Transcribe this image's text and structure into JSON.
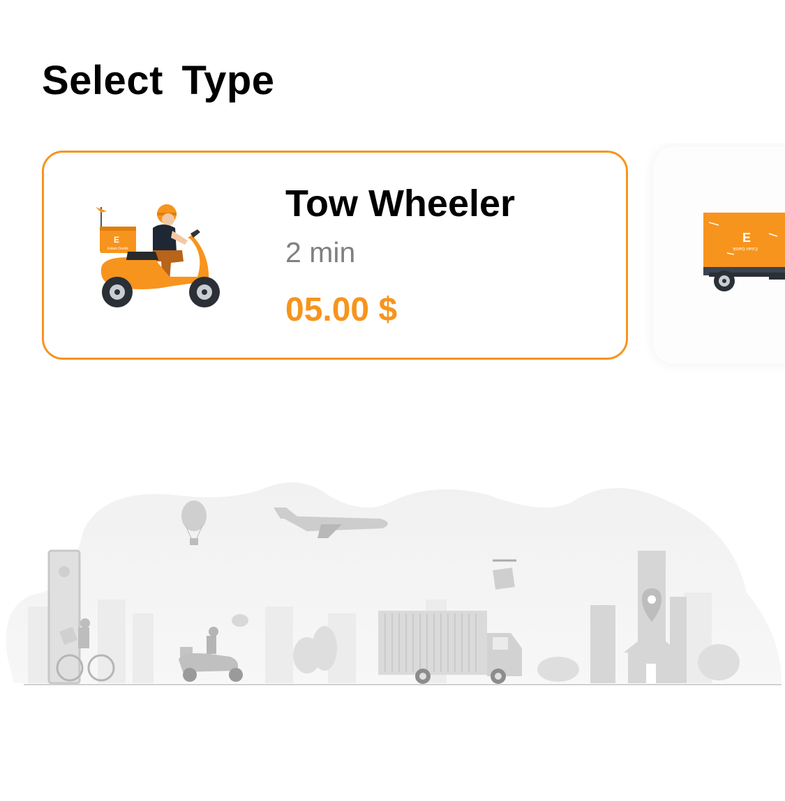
{
  "header": {
    "title": "Select  Type"
  },
  "vehicle_types": [
    {
      "name": "Tow Wheeler",
      "eta": "2 min",
      "price": "05.00 $",
      "selected": true,
      "icon": "scooter-delivery-icon",
      "brand_text": "Eslam Darbik"
    },
    {
      "icon": "truck-delivery-icon",
      "selected": false,
      "brand_text": "Eslam Darbik"
    }
  ],
  "colors": {
    "accent": "#F7941D",
    "text_primary": "#000000",
    "text_secondary": "#808080",
    "illustration_gray": "#e6e6e6"
  }
}
